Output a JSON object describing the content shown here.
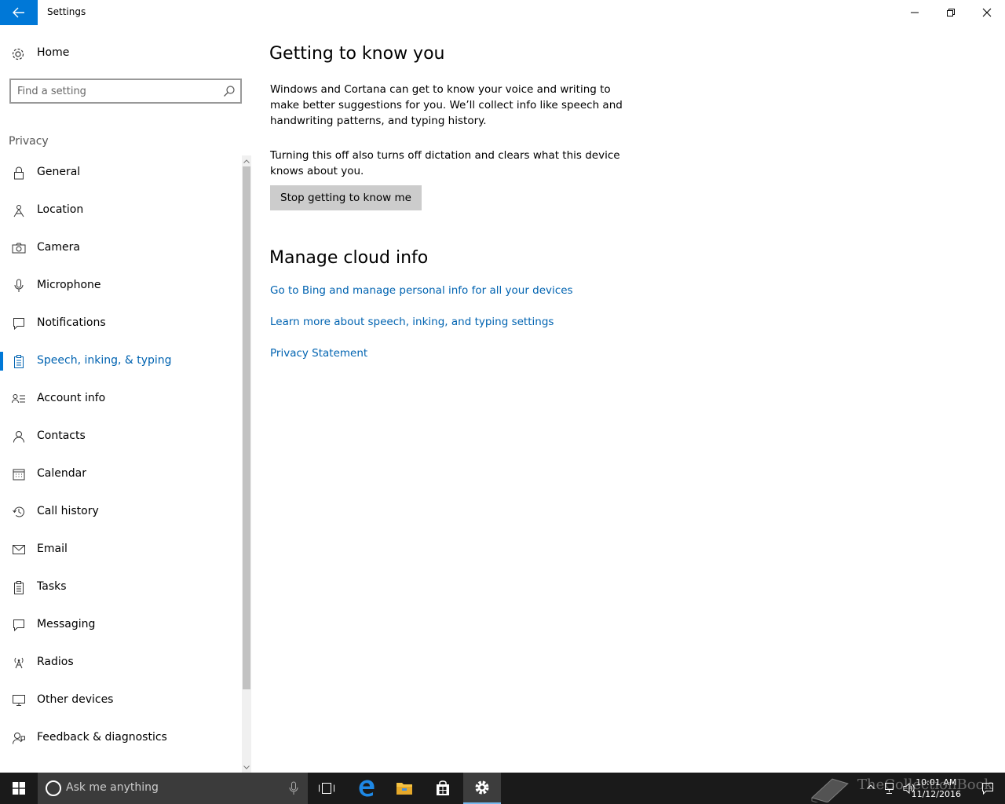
{
  "window": {
    "title": "Settings"
  },
  "sidebar": {
    "home_label": "Home",
    "search_placeholder": "Find a setting",
    "group_label": "Privacy",
    "items": [
      {
        "label": "General",
        "icon": "lock-icon"
      },
      {
        "label": "Location",
        "icon": "location-icon"
      },
      {
        "label": "Camera",
        "icon": "camera-icon"
      },
      {
        "label": "Microphone",
        "icon": "microphone-icon"
      },
      {
        "label": "Notifications",
        "icon": "notification-icon"
      },
      {
        "label": "Speech, inking, & typing",
        "icon": "clipboard-icon",
        "selected": true
      },
      {
        "label": "Account info",
        "icon": "account-info-icon"
      },
      {
        "label": "Contacts",
        "icon": "contacts-icon"
      },
      {
        "label": "Calendar",
        "icon": "calendar-icon"
      },
      {
        "label": "Call history",
        "icon": "history-icon"
      },
      {
        "label": "Email",
        "icon": "email-icon"
      },
      {
        "label": "Tasks",
        "icon": "tasks-icon"
      },
      {
        "label": "Messaging",
        "icon": "messaging-icon"
      },
      {
        "label": "Radios",
        "icon": "radio-tower-icon"
      },
      {
        "label": "Other devices",
        "icon": "devices-icon"
      },
      {
        "label": "Feedback & diagnostics",
        "icon": "feedback-icon"
      }
    ]
  },
  "main": {
    "section1_title": "Getting to know you",
    "section1_para1": "Windows and Cortana can get to know your voice and writing to make better suggestions for you. We’ll collect info like speech and handwriting patterns, and typing history.",
    "section1_para2": "Turning this off also turns off dictation and clears what this device knows about you.",
    "section1_button": "Stop getting to know me",
    "section2_title": "Manage cloud info",
    "links": [
      "Go to Bing and manage personal info for all your devices",
      "Learn more about speech, inking, and typing settings",
      "Privacy Statement"
    ]
  },
  "taskbar": {
    "search_placeholder": "Ask me anything",
    "time": "10:01 AM",
    "date": "11/12/2016"
  },
  "watermark": {
    "text": "TheCollectionBook"
  },
  "colors": {
    "accent": "#0078d7",
    "link": "#0063b1",
    "taskbar": "#1a1a1a"
  }
}
